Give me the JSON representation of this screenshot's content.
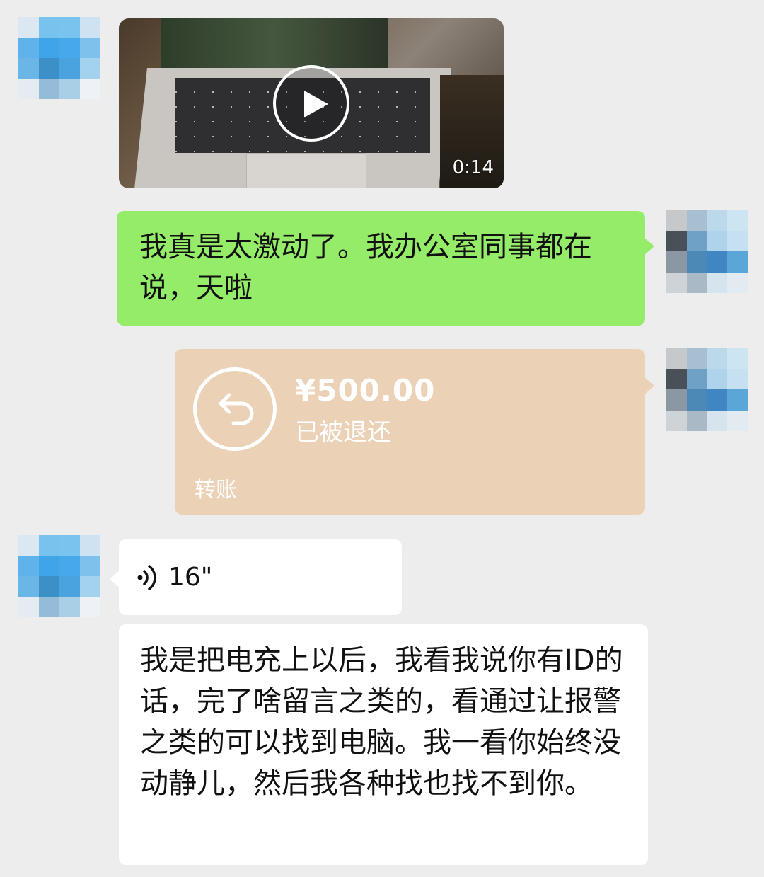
{
  "video_message": {
    "duration": "0:14"
  },
  "messages": {
    "sent_text": "我真是太激动了。我办公室同事都在说，天啦",
    "received_long": "我是把电充上以后，我看我说你有ID的话，完了啥留言之类的，看通过让报警之类的可以找到电脑。我一看你始终没动静儿，然后我各种找也找不到你。"
  },
  "transfer": {
    "amount": "¥500.00",
    "status": "已被退还",
    "label": "转账"
  },
  "voice_message": {
    "duration": "16\""
  },
  "colors": {
    "background": "#ededed",
    "sent_bubble": "#95ec69",
    "received_bubble": "#ffffff",
    "transfer_card": "#ebd2b6"
  },
  "icons": [
    "play-icon",
    "return-arrow-icon",
    "voice-wave-icon"
  ]
}
